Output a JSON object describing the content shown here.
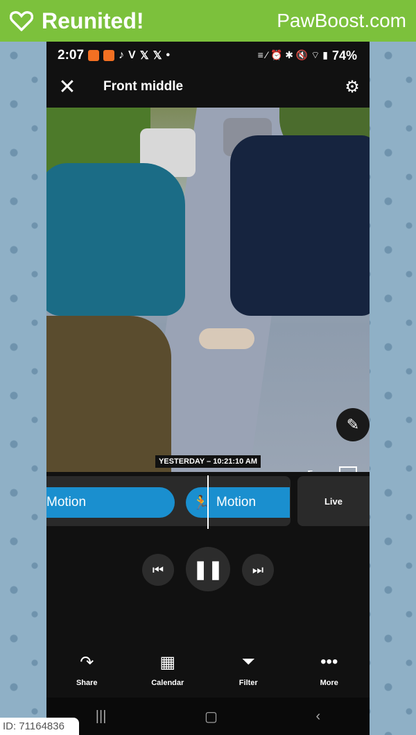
{
  "banner": {
    "title": "Reunited!",
    "brand": "PawBoost.com",
    "heart_icon": "heart-icon"
  },
  "statusbar": {
    "time": "2:07",
    "app_icons": [
      "V",
      "𝕏",
      "𝕏",
      "•"
    ],
    "battery": "74%",
    "status_icons": "≡ ⁄ ⏰ ✱ 🔇 ⌔ ▮"
  },
  "appbar": {
    "title": "Front middle"
  },
  "video": {
    "description_icons": [
      "edit-icon",
      "shrink-icon",
      "fullscreen-icon"
    ]
  },
  "timeline": {
    "timestamp": "YESTERDAY – 10:21:10 AM",
    "event1": "Motion",
    "event2": "Motion",
    "live": "Live"
  },
  "actions": [
    {
      "label": "Share",
      "icon": "↷"
    },
    {
      "label": "Calendar",
      "icon": "▦"
    },
    {
      "label": "Filter",
      "icon": "⏷"
    },
    {
      "label": "More",
      "icon": "•••"
    }
  ],
  "id_tag": "ID: 71164836"
}
